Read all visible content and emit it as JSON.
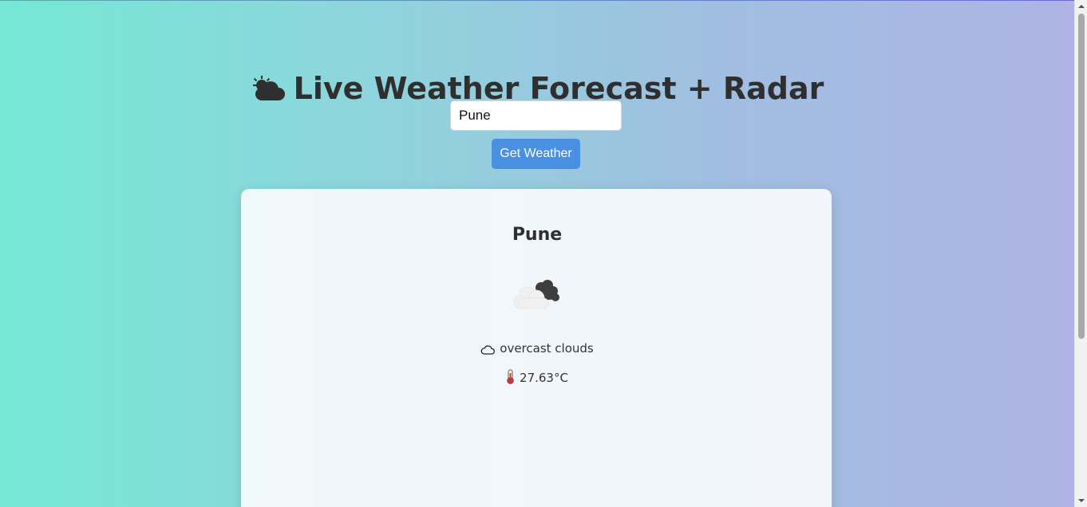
{
  "header": {
    "title": "Live Weather Forecast + Radar",
    "title_icon": "sun-behind-cloud-icon"
  },
  "search": {
    "value": "Pune",
    "button_label": "Get Weather"
  },
  "result": {
    "city": "Pune",
    "weather_icon": "overcast-clouds-icon",
    "description_icon": "cloud-icon",
    "description": "overcast clouds",
    "temperature_icon": "thermometer-icon",
    "temperature": "27.63°C"
  },
  "colors": {
    "gradient_left": "#75e8d5",
    "gradient_right": "#aeb3e5",
    "button": "#4a90e2",
    "card": "#f5f8fa",
    "text": "#2f2f2f"
  }
}
